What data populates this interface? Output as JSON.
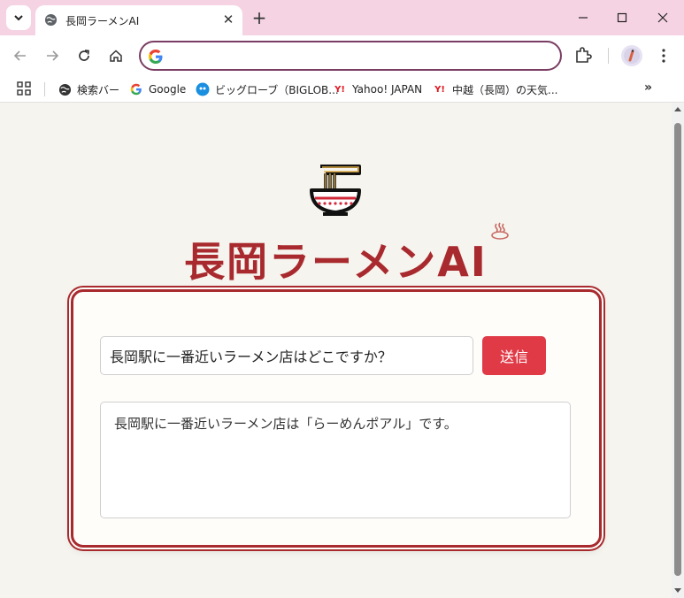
{
  "browser": {
    "tab": {
      "title": "長岡ラーメンAI",
      "close": "✕"
    },
    "new_tab": "+",
    "window": {
      "minimize": "—",
      "maximize": "☐",
      "close": "✕"
    },
    "omnibox": {
      "value": "",
      "placeholder": ""
    },
    "bookmarks": [
      {
        "label": "検索バー",
        "icon": "globe-icon"
      },
      {
        "label": "Google",
        "icon": "google-icon"
      },
      {
        "label": "ビッグローブ（BIGLOB...",
        "icon": "biglobe-icon"
      },
      {
        "label": "Yahoo! JAPAN",
        "icon": "yahoo-icon"
      },
      {
        "label": "中越（長岡）の天気...",
        "icon": "yahoo-icon"
      }
    ],
    "more": "»"
  },
  "page": {
    "title": "長岡ラーメンAI",
    "question": {
      "value": "長岡駅に一番近いラーメン店はどこですか？"
    },
    "send_label": "送信",
    "answer": "長岡駅に一番近いラーメン店は「らーめんポアル」です。"
  },
  "colors": {
    "accent": "#a82a2e",
    "button": "#e03a47",
    "tabbar": "#f5d3e3",
    "omnibox_border": "#7a3d63"
  }
}
